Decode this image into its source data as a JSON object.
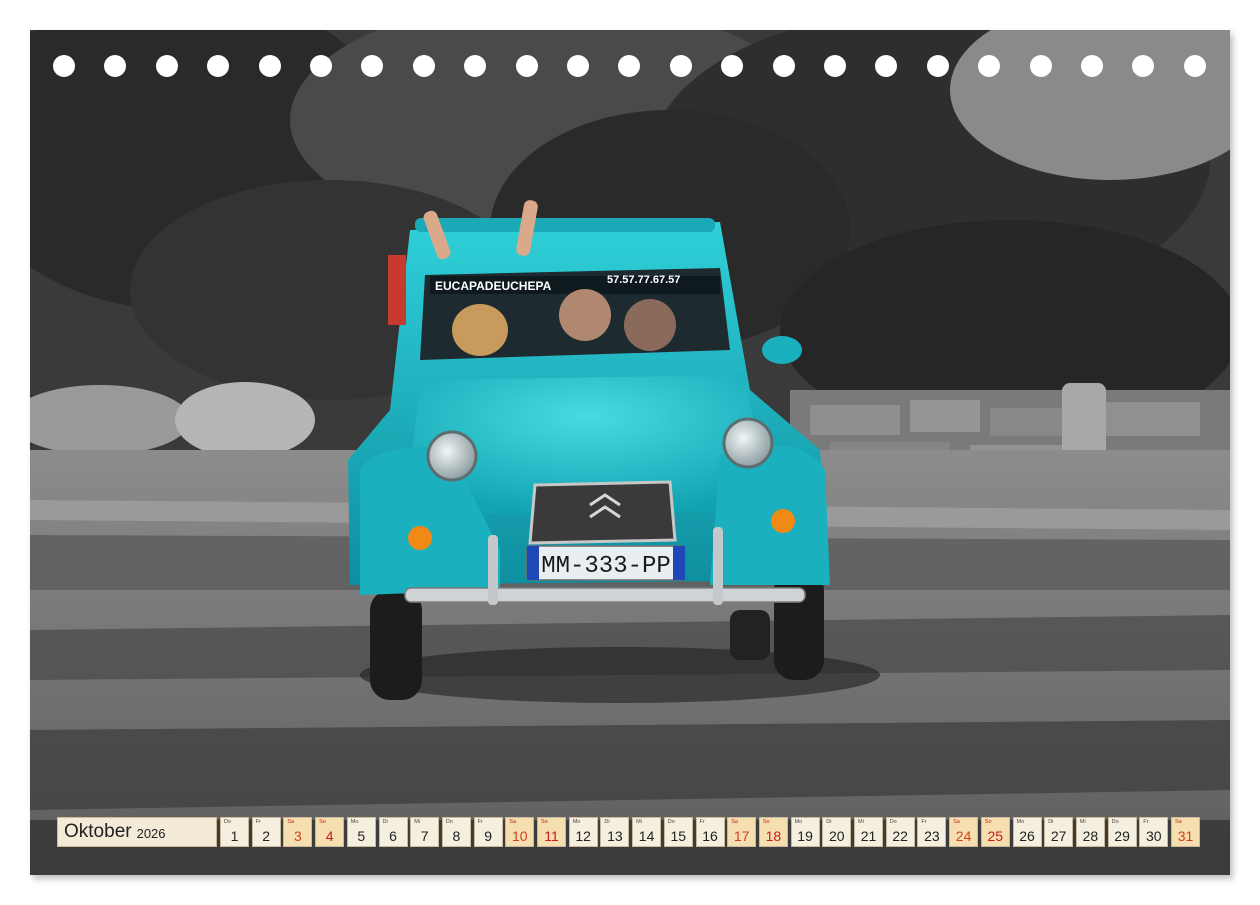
{
  "calendar": {
    "month": "Oktober",
    "year": "2026",
    "days": [
      {
        "dow": "Do",
        "num": "1",
        "type": "weekday"
      },
      {
        "dow": "Fr",
        "num": "2",
        "type": "weekday"
      },
      {
        "dow": "Sa",
        "num": "3",
        "type": "saturday"
      },
      {
        "dow": "So",
        "num": "4",
        "type": "sunday"
      },
      {
        "dow": "Mo",
        "num": "5",
        "type": "weekday"
      },
      {
        "dow": "Di",
        "num": "6",
        "type": "weekday"
      },
      {
        "dow": "Mi",
        "num": "7",
        "type": "weekday"
      },
      {
        "dow": "Do",
        "num": "8",
        "type": "weekday"
      },
      {
        "dow": "Fr",
        "num": "9",
        "type": "weekday"
      },
      {
        "dow": "Sa",
        "num": "10",
        "type": "saturday"
      },
      {
        "dow": "So",
        "num": "11",
        "type": "sunday"
      },
      {
        "dow": "Mo",
        "num": "12",
        "type": "weekday"
      },
      {
        "dow": "Di",
        "num": "13",
        "type": "weekday"
      },
      {
        "dow": "Mi",
        "num": "14",
        "type": "weekday"
      },
      {
        "dow": "Do",
        "num": "15",
        "type": "weekday"
      },
      {
        "dow": "Fr",
        "num": "16",
        "type": "weekday"
      },
      {
        "dow": "Sa",
        "num": "17",
        "type": "saturday"
      },
      {
        "dow": "So",
        "num": "18",
        "type": "sunday"
      },
      {
        "dow": "Mo",
        "num": "19",
        "type": "weekday"
      },
      {
        "dow": "Di",
        "num": "20",
        "type": "weekday"
      },
      {
        "dow": "Mi",
        "num": "21",
        "type": "weekday"
      },
      {
        "dow": "Do",
        "num": "22",
        "type": "weekday"
      },
      {
        "dow": "Fr",
        "num": "23",
        "type": "weekday"
      },
      {
        "dow": "Sa",
        "num": "24",
        "type": "saturday"
      },
      {
        "dow": "So",
        "num": "25",
        "type": "sunday"
      },
      {
        "dow": "Mo",
        "num": "26",
        "type": "weekday"
      },
      {
        "dow": "Di",
        "num": "27",
        "type": "weekday"
      },
      {
        "dow": "Mi",
        "num": "28",
        "type": "weekday"
      },
      {
        "dow": "Do",
        "num": "29",
        "type": "weekday"
      },
      {
        "dow": "Fr",
        "num": "30",
        "type": "weekday"
      },
      {
        "dow": "Sa",
        "num": "31",
        "type": "saturday"
      }
    ]
  },
  "photo": {
    "windshield_banner": "EUCAPADEUCHEPA",
    "windshield_phone": "57.57.77.67.57",
    "license_plate": "MM-333-PP",
    "car_color": "#1fb8c4",
    "subject": "car-photo"
  },
  "colors": {
    "weekend_cell": "#f5deaf",
    "weekday_cell": "#f5efe0",
    "weekend_text": "#d2401e"
  }
}
